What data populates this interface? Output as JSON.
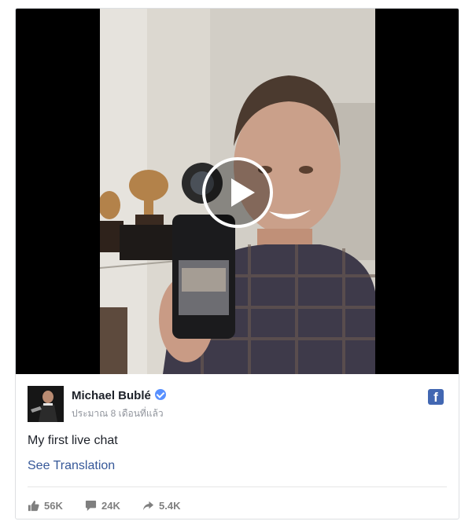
{
  "post": {
    "author_name": "Michael Bublé",
    "timestamp": "ประมาณ 8 เดือนที่แล้ว",
    "text": "My first live chat",
    "see_translation": "See Translation",
    "brand_icon": "facebook-icon",
    "verified_icon": "verified-badge-icon"
  },
  "video": {
    "play_icon": "play-icon"
  },
  "stats": {
    "likes": "56K",
    "comments": "24K",
    "shares": "5.4K"
  },
  "colors": {
    "facebook_blue": "#4267b2",
    "link_blue": "#365899",
    "verified_blue": "#5890ff",
    "muted_gray": "#90949c"
  }
}
